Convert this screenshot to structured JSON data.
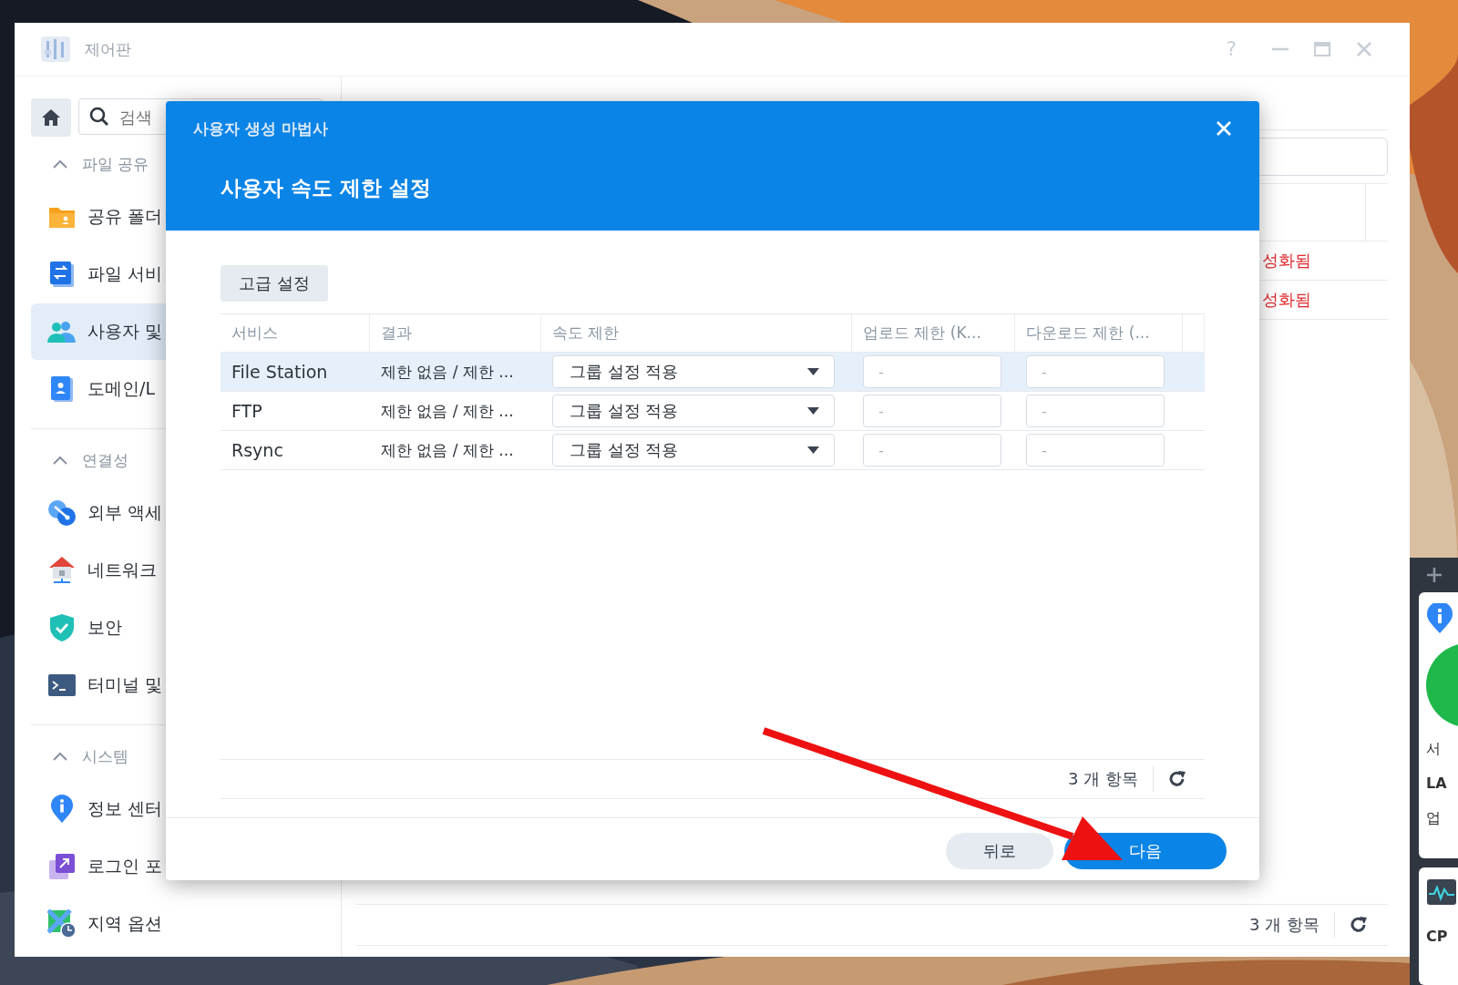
{
  "window": {
    "title": "제어판",
    "help": "?"
  },
  "sidebar": {
    "search": {
      "placeholder": "검색"
    },
    "sections": [
      {
        "title": "파일 공유",
        "expanded": true,
        "items": [
          {
            "label": "공유 폴더",
            "kind": "folder",
            "selected": false
          },
          {
            "label": "파일 서비",
            "kind": "file",
            "selected": false
          },
          {
            "label": "사용자 및",
            "kind": "users",
            "selected": true
          },
          {
            "label": "도메인/L",
            "kind": "domain",
            "selected": false
          }
        ]
      },
      {
        "title": "연결성",
        "expanded": true,
        "items": [
          {
            "label": "외부 액세",
            "kind": "link",
            "selected": false
          },
          {
            "label": "네트워크",
            "kind": "network",
            "selected": false
          },
          {
            "label": "보안",
            "kind": "security",
            "selected": false
          },
          {
            "label": "터미널 및",
            "kind": "terminal",
            "selected": false
          }
        ]
      },
      {
        "title": "시스템",
        "expanded": true,
        "items": [
          {
            "label": "정보 센터",
            "kind": "info",
            "selected": false
          },
          {
            "label": "로그인 포",
            "kind": "login",
            "selected": false
          },
          {
            "label": "지역 옵션",
            "kind": "region",
            "selected": false
          }
        ]
      }
    ]
  },
  "background_table": {
    "rows": [
      {
        "status": "성화됨"
      },
      {
        "status": "성화됨"
      }
    ],
    "footer": {
      "count": "3 개 항목"
    }
  },
  "dialog": {
    "wizard": "사용자 생성 마법사",
    "title": "사용자 속도 제한 설정",
    "advanced_button": "고급 설정",
    "columns": [
      "서비스",
      "결과",
      "속도 제한",
      "업로드 제한 (K...",
      "다운로드 제한 (..."
    ],
    "rows": [
      {
        "service": "File Station",
        "result": "제한 없음 / 제한 ...",
        "speed_limit": "그룹 설정 적용",
        "upload_limit": {
          "placeholder": "-"
        },
        "download_limit": {
          "placeholder": "-"
        },
        "selected": true
      },
      {
        "service": "FTP",
        "result": "제한 없음 / 제한 ...",
        "speed_limit": "그룹 설정 적용",
        "upload_limit": {
          "placeholder": "-"
        },
        "download_limit": {
          "placeholder": "-"
        },
        "selected": false
      },
      {
        "service": "Rsync",
        "result": "제한 없음 / 제한 ...",
        "speed_limit": "그룹 설정 적용",
        "upload_limit": {
          "placeholder": "-"
        },
        "download_limit": {
          "placeholder": "-"
        },
        "selected": false
      }
    ],
    "footer": {
      "count": "3 개 항목"
    },
    "buttons": [
      {
        "label": "뒤로",
        "kind": "secondary"
      },
      {
        "label": "다음",
        "kind": "primary"
      }
    ]
  },
  "widgets": {
    "status_card": {
      "lines": [
        {
          "text": "서",
          "kind": "normal"
        },
        {
          "text": "LA",
          "kind": "bold"
        },
        {
          "text": "업",
          "kind": "normal"
        }
      ]
    },
    "cpu_card": {
      "label": "CP"
    }
  }
}
